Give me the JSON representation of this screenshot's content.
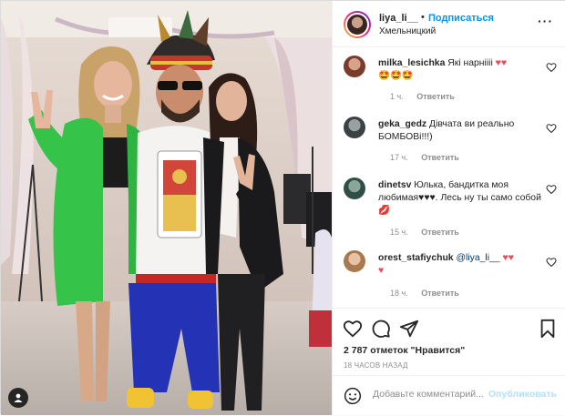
{
  "post": {
    "username": "liya_li__",
    "dot": "•",
    "follow_label": "Подписаться",
    "location": "Хмельницкий",
    "more_label": "···"
  },
  "comments": [
    {
      "user": "milka_lesichka",
      "text": "Які нарніііі",
      "emoji_line": "🤩🤩🤩",
      "time": "1 ч.",
      "reply_label": "Ответить"
    },
    {
      "user": "geka_gedz",
      "text": "Дівчата ви реально БОМБОВі!!!)",
      "time": "17 ч.",
      "reply_label": "Ответить"
    },
    {
      "user": "dinetsv",
      "text": "Юлька, бандитка моя любимая♥♥♥. Лесь ну ты само собой💋",
      "time": "15 ч.",
      "reply_label": "Ответить"
    },
    {
      "user": "orest_stafiychuk",
      "mention": "@liya_li__",
      "time": "18 ч.",
      "reply_label": "Ответить"
    }
  ],
  "likes_text": "2 787 отметок \"Нравится\"",
  "posted_time": "18 ЧАСОВ НАЗАД",
  "add_comment": {
    "placeholder": "Добавьте комментарий...",
    "publish_label": "Опубликовать"
  },
  "colors": {
    "link_blue": "#0095f6",
    "muted": "#8e8e8e",
    "heart_red": "#ed4956",
    "publish_disabled": "#b2dffc"
  },
  "icons": [
    "like-icon",
    "comment-icon",
    "share-icon",
    "save-icon",
    "emoji-icon",
    "more-icon",
    "person-tag-icon"
  ]
}
